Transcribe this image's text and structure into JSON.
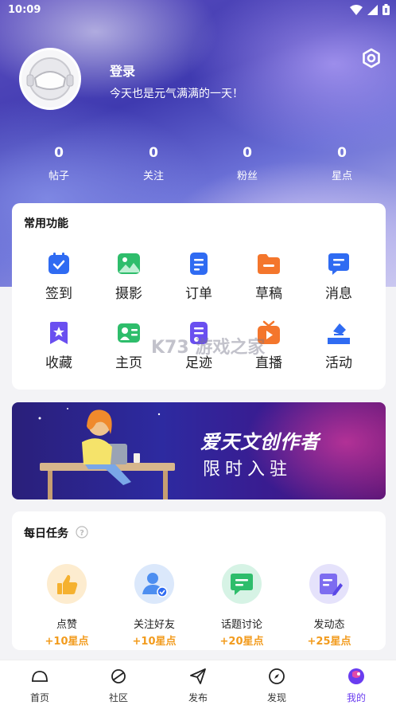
{
  "status_bar": {
    "time": "10:09"
  },
  "profile": {
    "title": "登录",
    "subtitle": "今天也是元气满满的一天！",
    "stats": [
      {
        "value": "0",
        "label": "帖子"
      },
      {
        "value": "0",
        "label": "关注"
      },
      {
        "value": "0",
        "label": "粉丝"
      },
      {
        "value": "0",
        "label": "星点"
      }
    ]
  },
  "functions": {
    "title": "常用功能",
    "items": [
      {
        "label": "签到",
        "icon": "calendar-check-icon",
        "color": "#2f6bf2"
      },
      {
        "label": "摄影",
        "icon": "image-icon",
        "color": "#2ebd6b"
      },
      {
        "label": "订单",
        "icon": "order-icon",
        "color": "#2f6bf2"
      },
      {
        "label": "草稿",
        "icon": "folder-icon",
        "color": "#f4762c"
      },
      {
        "label": "消息",
        "icon": "message-icon",
        "color": "#2f6bf2"
      },
      {
        "label": "收藏",
        "icon": "bookmark-star-icon",
        "color": "#6a4ff0"
      },
      {
        "label": "主页",
        "icon": "profile-card-icon",
        "color": "#2ebd6b"
      },
      {
        "label": "足迹",
        "icon": "footprint-icon",
        "color": "#6a4ff0"
      },
      {
        "label": "直播",
        "icon": "tv-play-icon",
        "color": "#f4762c"
      },
      {
        "label": "活动",
        "icon": "activity-icon",
        "color": "#2f6bf2"
      }
    ]
  },
  "banner": {
    "title": "爱天文创作者",
    "subtitle": "限时入驻"
  },
  "daily_tasks": {
    "title": "每日任务",
    "items": [
      {
        "name": "点赞",
        "points": "+10星点",
        "icon": "thumbs-up-icon"
      },
      {
        "name": "关注好友",
        "points": "+10星点",
        "icon": "follow-user-icon"
      },
      {
        "name": "话题讨论",
        "points": "+20星点",
        "icon": "chat-icon"
      },
      {
        "name": "发动态",
        "points": "+25星点",
        "icon": "edit-note-icon"
      }
    ]
  },
  "tabbar": {
    "items": [
      {
        "label": "首页",
        "active": false
      },
      {
        "label": "社区",
        "active": false
      },
      {
        "label": "发布",
        "active": false
      },
      {
        "label": "发现",
        "active": false
      },
      {
        "label": "我的",
        "active": true
      }
    ]
  },
  "watermark": "K73 游戏之家",
  "colors": {
    "accent": "#6a3cf0",
    "points": "#f29b1d"
  }
}
